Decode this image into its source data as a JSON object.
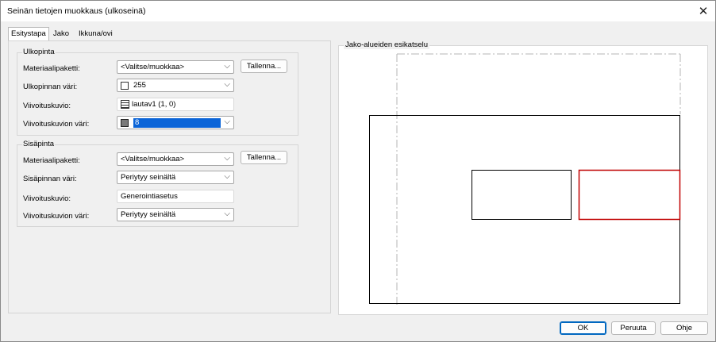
{
  "window": {
    "title": "Seinän tietojen muokkaus (ulkoseinä)",
    "close_glyph": "✕"
  },
  "tabs": [
    {
      "label": "Esitystapa",
      "active": true
    },
    {
      "label": "Jako",
      "active": false
    },
    {
      "label": "Ikkuna/ovi",
      "active": false
    }
  ],
  "outer": {
    "group_title": "Ulkopinta",
    "material_label": "Materiaalipaketti:",
    "material_value": "<Valitse/muokkaa>",
    "save_button": "Tallenna...",
    "color_label": "Ulkopinnan väri:",
    "color_value": "255",
    "hatch_label": "Viivoituskuvio:",
    "hatch_value": "lautav1 (1, 0)",
    "hatch_color_label": "Viivoituskuvion väri:",
    "hatch_color_value": "8"
  },
  "inner": {
    "group_title": "Sisäpinta",
    "material_label": "Materiaalipaketti:",
    "material_value": "<Valitse/muokkaa>",
    "save_button": "Tallenna...",
    "color_label": "Sisäpinnan väri:",
    "color_value": "Periytyy seinältä",
    "hatch_label": "Viivoituskuvio:",
    "hatch_value": "Generointiasetus",
    "hatch_color_label": "Viivoituskuvion väri:",
    "hatch_color_value": "Periytyy seinältä"
  },
  "preview": {
    "group_title": "Jako-alueiden esikatselu",
    "colors": {
      "outline": "#000000",
      "dash": "#b4b4b4",
      "highlight": "#c00000"
    }
  },
  "footer": {
    "ok": "OK",
    "cancel": "Peruuta",
    "help": "Ohje"
  },
  "icons": {
    "close": "close-icon",
    "chevron": "chevron-down-icon",
    "hatch": "hatch-pattern-icon",
    "swatch": "color-swatch-icon"
  }
}
